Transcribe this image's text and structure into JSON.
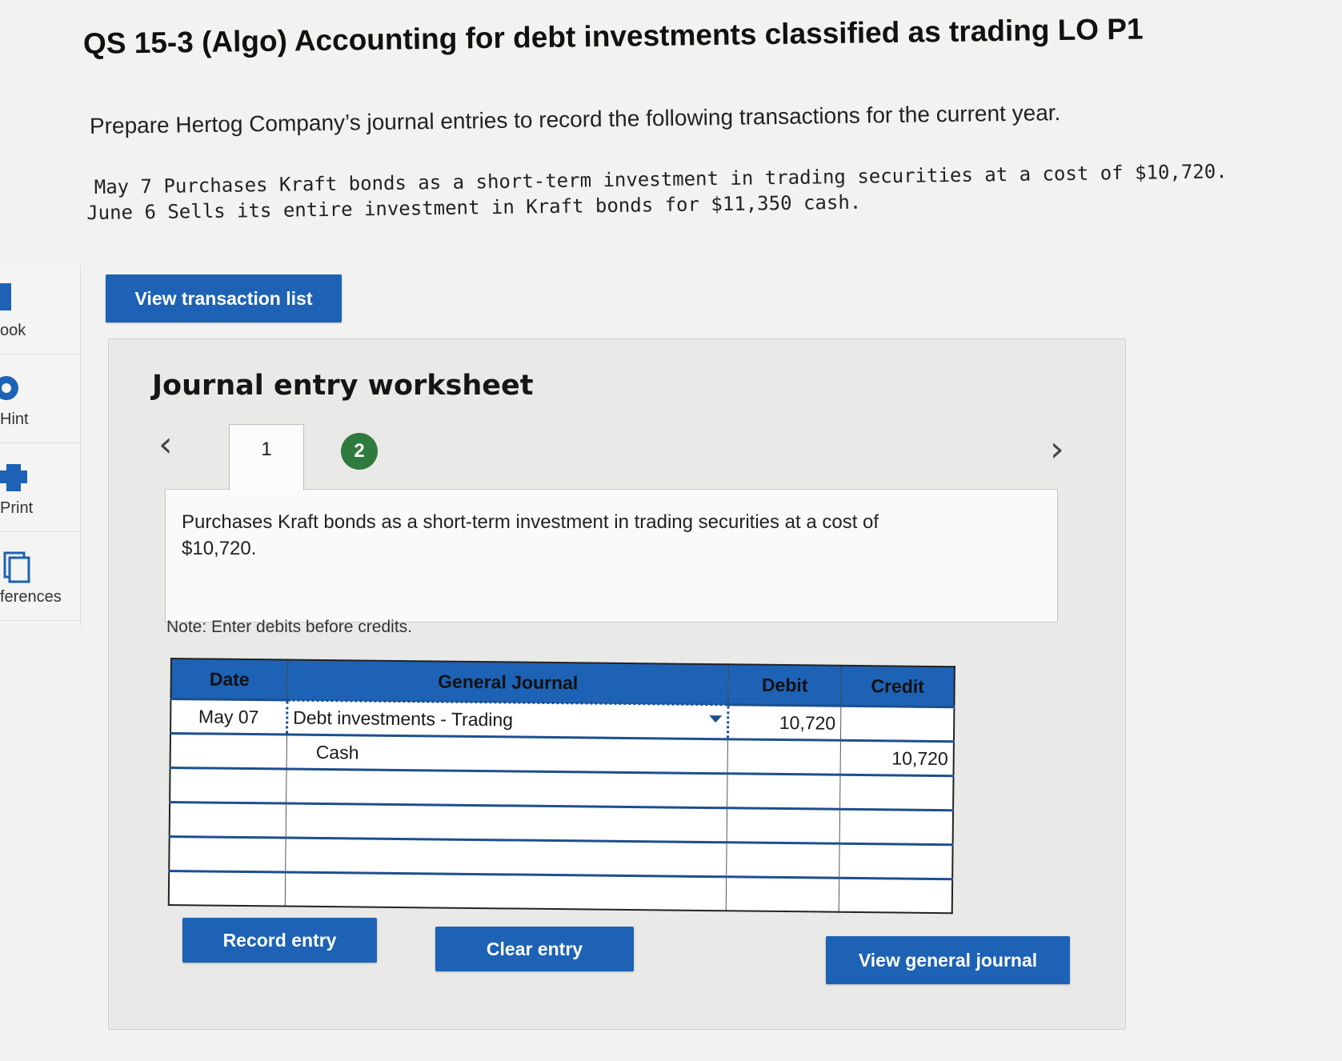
{
  "title": "QS 15-3 (Algo) Accounting for debt investments classified as trading LO P1",
  "intro": "Prepare Hertog Company’s journal entries to record the following transactions for the current year.",
  "transactions": [
    "May 7 Purchases Kraft bonds as a short-term investment in trading securities at a cost of $10,720.",
    "June 6 Sells its entire investment in Kraft bonds for $11,350 cash."
  ],
  "sidebar": {
    "items": [
      {
        "label": "ook",
        "icon": "book-icon"
      },
      {
        "label": "Hint",
        "icon": "hint-icon"
      },
      {
        "label": "Print",
        "icon": "print-icon"
      },
      {
        "label": "ferences",
        "icon": "references-icon"
      }
    ]
  },
  "buttons": {
    "view_transaction_list": "View transaction list",
    "record_entry": "Record entry",
    "clear_entry": "Clear entry",
    "view_general_journal": "View general journal"
  },
  "worksheet": {
    "title": "Journal entry worksheet",
    "tabs": [
      "1",
      "2"
    ],
    "description": "Purchases Kraft bonds as a short-term investment in trading securities at a cost of $10,720.",
    "note": "Note: Enter debits before credits."
  },
  "journal": {
    "headers": {
      "date": "Date",
      "account": "General Journal",
      "debit": "Debit",
      "credit": "Credit"
    },
    "rows": [
      {
        "date": "May 07",
        "account": "Debt investments - Trading",
        "debit": "10,720",
        "credit": ""
      },
      {
        "date": "",
        "account": "Cash",
        "debit": "",
        "credit": "10,720"
      },
      {
        "date": "",
        "account": "",
        "debit": "",
        "credit": ""
      },
      {
        "date": "",
        "account": "",
        "debit": "",
        "credit": ""
      },
      {
        "date": "",
        "account": "",
        "debit": "",
        "credit": ""
      },
      {
        "date": "",
        "account": "",
        "debit": "",
        "credit": ""
      }
    ]
  },
  "colors": {
    "accent": "#1d62b5",
    "tab_active_green": "#2f7a3d"
  }
}
